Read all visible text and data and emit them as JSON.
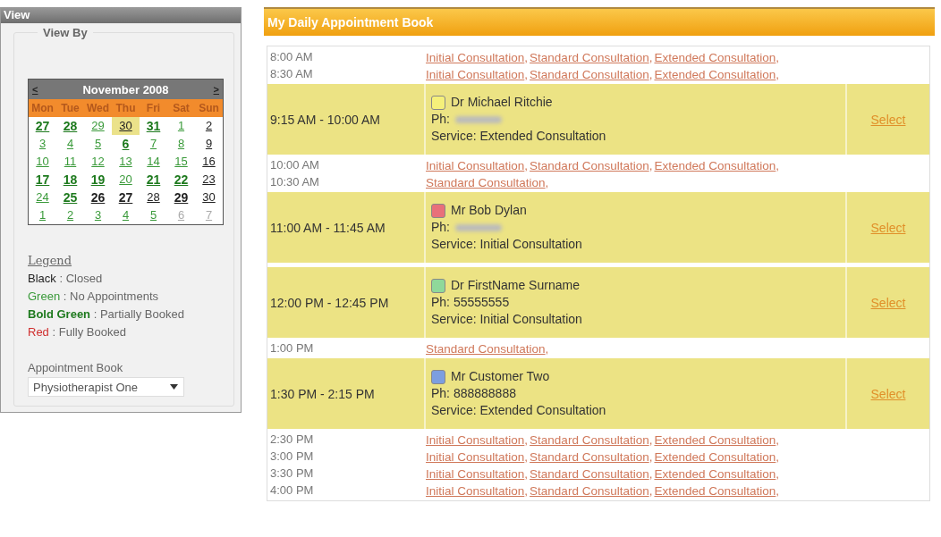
{
  "view_panel": {
    "title": "View",
    "fieldset_legend": "View By",
    "calendar": {
      "prev": "<",
      "next": ">",
      "month": "November 2008",
      "weekdays": [
        "Mon",
        "Tue",
        "Wed",
        "Thu",
        "Fri",
        "Sat",
        "Sun"
      ],
      "weeks": [
        [
          {
            "day": "27",
            "kind": "partial",
            "selected": false
          },
          {
            "day": "28",
            "kind": "partial",
            "selected": false
          },
          {
            "day": "29",
            "kind": "free",
            "selected": false
          },
          {
            "day": "30",
            "kind": "closed",
            "selected": true
          },
          {
            "day": "31",
            "kind": "partial",
            "selected": false
          },
          {
            "day": "1",
            "kind": "free",
            "selected": false
          },
          {
            "day": "2",
            "kind": "closed",
            "selected": false
          }
        ],
        [
          {
            "day": "3",
            "kind": "free",
            "selected": false
          },
          {
            "day": "4",
            "kind": "free",
            "selected": false
          },
          {
            "day": "5",
            "kind": "free",
            "selected": false
          },
          {
            "day": "6",
            "kind": "partial",
            "selected": false
          },
          {
            "day": "7",
            "kind": "free",
            "selected": false
          },
          {
            "day": "8",
            "kind": "free",
            "selected": false
          },
          {
            "day": "9",
            "kind": "closed",
            "selected": false
          }
        ],
        [
          {
            "day": "10",
            "kind": "free",
            "selected": false
          },
          {
            "day": "11",
            "kind": "free",
            "selected": false
          },
          {
            "day": "12",
            "kind": "free",
            "selected": false
          },
          {
            "day": "13",
            "kind": "free",
            "selected": false
          },
          {
            "day": "14",
            "kind": "free",
            "selected": false
          },
          {
            "day": "15",
            "kind": "free",
            "selected": false
          },
          {
            "day": "16",
            "kind": "closed",
            "selected": false
          }
        ],
        [
          {
            "day": "17",
            "kind": "partial",
            "selected": false
          },
          {
            "day": "18",
            "kind": "partial",
            "selected": false
          },
          {
            "day": "19",
            "kind": "partial",
            "selected": false
          },
          {
            "day": "20",
            "kind": "free",
            "selected": false
          },
          {
            "day": "21",
            "kind": "partial",
            "selected": false
          },
          {
            "day": "22",
            "kind": "partial",
            "selected": false
          },
          {
            "day": "23",
            "kind": "closed",
            "selected": false
          }
        ],
        [
          {
            "day": "24",
            "kind": "free",
            "selected": false
          },
          {
            "day": "25",
            "kind": "partial",
            "selected": false
          },
          {
            "day": "26",
            "kind": "closedbold",
            "selected": false
          },
          {
            "day": "27",
            "kind": "closedbold",
            "selected": false
          },
          {
            "day": "28",
            "kind": "closed",
            "selected": false
          },
          {
            "day": "29",
            "kind": "closedbold",
            "selected": false
          },
          {
            "day": "30",
            "kind": "closed",
            "selected": false
          }
        ],
        [
          {
            "day": "1",
            "kind": "free",
            "selected": false
          },
          {
            "day": "2",
            "kind": "free",
            "selected": false
          },
          {
            "day": "3",
            "kind": "free",
            "selected": false
          },
          {
            "day": "4",
            "kind": "free",
            "selected": false
          },
          {
            "day": "5",
            "kind": "free",
            "selected": false
          },
          {
            "day": "6",
            "kind": "other",
            "selected": false
          },
          {
            "day": "7",
            "kind": "other",
            "selected": false
          }
        ]
      ]
    },
    "legend": {
      "title": "Legend",
      "items": [
        {
          "key": "Black",
          "meaning": ": Closed",
          "kind": "black"
        },
        {
          "key": "Green",
          "meaning": ": No Appointments",
          "kind": "green"
        },
        {
          "key": "Bold Green",
          "meaning": ": Partially Booked",
          "kind": "bold-green"
        },
        {
          "key": "Red",
          "meaning": ": Fully Booked",
          "kind": "red"
        }
      ]
    },
    "appointment_book": {
      "label": "Appointment Book",
      "value": "Physiotherapist One"
    }
  },
  "schedule": {
    "title": "My Daily Appointment Book",
    "separator": ",",
    "rows": [
      {
        "kind": "open",
        "slots": [
          {
            "time": "8:00 AM",
            "links": [
              "Initial Consultation",
              "Standard Consultation",
              "Extended Consultation"
            ]
          },
          {
            "time": "8:30 AM",
            "links": [
              "Initial Consultation",
              "Standard Consultation",
              "Extended Consultation"
            ]
          }
        ]
      },
      {
        "kind": "booked",
        "time": "9:15 AM - 10:00 AM",
        "color": "#f5f07a",
        "name": "Dr Michael Ritchie",
        "phone_label": "Ph:",
        "phone_hidden": true,
        "service": "Service: Extended Consultation",
        "action": "Select"
      },
      {
        "kind": "open",
        "slots": [
          {
            "time": "10:00 AM",
            "links": [
              "Initial Consultation",
              "Standard Consultation",
              "Extended Consultation"
            ]
          },
          {
            "time": "10:30 AM",
            "links": [
              "Standard Consultation"
            ]
          }
        ]
      },
      {
        "kind": "booked",
        "time": "11:00 AM - 11:45 AM",
        "color": "#e8707a",
        "name": "Mr Bob Dylan",
        "phone_label": "Ph:",
        "phone_hidden": true,
        "service": "Service: Initial Consultation",
        "action": "Select"
      },
      {
        "kind": "booked",
        "time": "12:00 PM - 12:45 PM",
        "color": "#8fd89a",
        "name": "Dr FirstName Surname",
        "phone_label": "Ph:",
        "phone": "55555555",
        "phone_hidden": false,
        "service": "Service: Initial Consultation",
        "action": "Select"
      },
      {
        "kind": "open",
        "slots": [
          {
            "time": "1:00 PM",
            "links": [
              "Standard Consultation"
            ]
          }
        ]
      },
      {
        "kind": "booked",
        "time": "1:30 PM - 2:15 PM",
        "color": "#7c9ee0",
        "name": "Mr Customer Two",
        "phone_label": "Ph:",
        "phone": "888888888",
        "phone_hidden": false,
        "service": "Service: Extended Consultation",
        "action": "Select"
      },
      {
        "kind": "open",
        "slots": [
          {
            "time": "2:30 PM",
            "links": [
              "Initial Consultation",
              "Standard Consultation",
              "Extended Consultation"
            ]
          },
          {
            "time": "3:00 PM",
            "links": [
              "Initial Consultation",
              "Standard Consultation",
              "Extended Consultation"
            ]
          },
          {
            "time": "3:30 PM",
            "links": [
              "Initial Consultation",
              "Standard Consultation",
              "Extended Consultation"
            ]
          },
          {
            "time": "4:00 PM",
            "links": [
              "Initial Consultation",
              "Standard Consultation",
              "Extended Consultation"
            ]
          }
        ]
      }
    ]
  }
}
